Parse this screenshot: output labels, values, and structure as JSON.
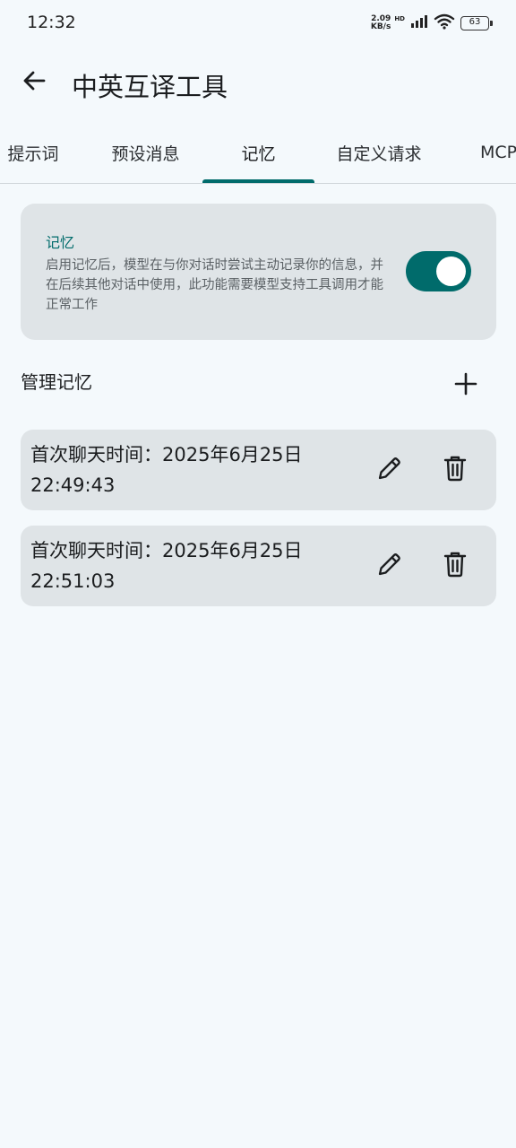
{
  "status_bar": {
    "time": "12:32",
    "net_speed_value": "2.09",
    "net_speed_unit": "KB/s",
    "hd_label": "HD",
    "battery": "63"
  },
  "app_bar": {
    "title": "中英互译工具"
  },
  "tabs": [
    {
      "label": "提示词",
      "selected": false
    },
    {
      "label": "预设消息",
      "selected": false
    },
    {
      "label": "记忆",
      "selected": true
    },
    {
      "label": "自定义请求",
      "selected": false
    },
    {
      "label": "MCP",
      "selected": false
    }
  ],
  "memory_card": {
    "title": "记忆",
    "description": "启用记忆后，模型在与你对话时尝试主动记录你的信息，并在后续其他对话中使用，此功能需要模型支持工具调用才能正常工作",
    "enabled": true
  },
  "manage": {
    "title": "管理记忆"
  },
  "memories": [
    {
      "line1": "首次聊天时间：2025年6月25日",
      "line2": "22:49:43"
    },
    {
      "line1": "首次聊天时间：2025年6月25日",
      "line2": "22:51:03"
    }
  ],
  "colors": {
    "accent": "#006b6b",
    "background": "#f4f9fc",
    "card": "#dfe4e7"
  }
}
